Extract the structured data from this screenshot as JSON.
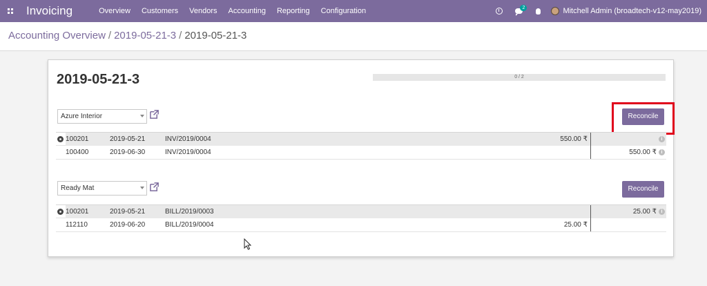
{
  "navbar": {
    "app_name": "Invoicing",
    "menu": [
      "Overview",
      "Customers",
      "Vendors",
      "Accounting",
      "Reporting",
      "Configuration"
    ],
    "chat_badge": "2",
    "user": "Mitchell Admin (broadtech-v12-may2019)"
  },
  "breadcrumb": {
    "items": [
      "Accounting Overview",
      "2019-05-21-3",
      "2019-05-21-3"
    ],
    "separator": "/"
  },
  "sheet": {
    "title": "2019-05-21-3",
    "progress_label": "0 / 2",
    "progress_value": 0,
    "reconcile_label": "Reconcile",
    "groups": [
      {
        "partner": "Azure Interior",
        "lines": [
          {
            "account": "100201",
            "date": "2019-05-21",
            "ref": "INV/2019/0004",
            "debit": "550.00 ₹",
            "credit": "",
            "selected": true
          },
          {
            "account": "100400",
            "date": "2019-06-30",
            "ref": "INV/2019/0004",
            "debit": "",
            "credit": "550.00 ₹",
            "selected": false
          }
        ]
      },
      {
        "partner": "Ready Mat",
        "lines": [
          {
            "account": "100201",
            "date": "2019-05-21",
            "ref": "BILL/2019/0003",
            "debit": "",
            "credit": "25.00 ₹",
            "selected": true
          },
          {
            "account": "112110",
            "date": "2019-06-20",
            "ref": "BILL/2019/0004",
            "debit": "25.00 ₹",
            "credit": "",
            "selected": false
          }
        ]
      }
    ]
  },
  "colors": {
    "brand": "#7c6b9d",
    "highlight": "#e0001b",
    "badge": "#00a09d"
  },
  "icons": [
    "apps-icon",
    "clock-icon",
    "chat-icon",
    "bug-icon",
    "external-link-icon",
    "gear-icon",
    "info-icon",
    "mouse-cursor-icon"
  ]
}
